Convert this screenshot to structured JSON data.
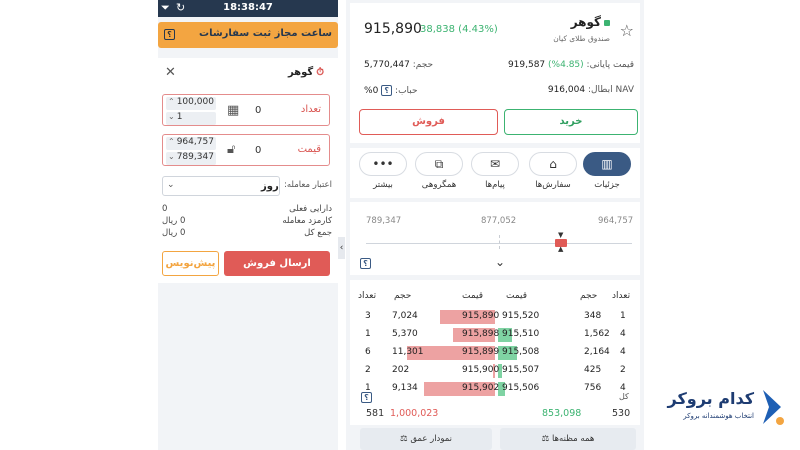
{
  "status_bar": {
    "time": "18:38:47"
  },
  "order_banner": {
    "text": "ساعت مجاز ثبت سفارشات",
    "help_badge": "؟"
  },
  "order_form": {
    "title": "گوهر",
    "close_glyph": "✕",
    "quantity": {
      "label": "تعداد",
      "value": "0",
      "step_large": "100,000",
      "step_small": "1"
    },
    "price": {
      "label": "قیمت",
      "value": "0",
      "upper": "964,757",
      "lower": "789,347"
    },
    "validity": {
      "label": "اعتبار معامله:",
      "value": "روز"
    },
    "info": [
      {
        "label": "دارایی فعلی",
        "value": "0"
      },
      {
        "label": "کارمزد معامله",
        "value": "0 ریال"
      },
      {
        "label": "جمع کل",
        "value": "0 ریال"
      }
    ],
    "send_sell_label": "ارسال فروش",
    "draft_label": "پیش‌نویس"
  },
  "collapse_glyph": "‹",
  "symbol": {
    "name": "گوهر",
    "subtitle": "صندوق طلای کیان",
    "last_price": "915,890",
    "change": "38,838 (4.43%)",
    "final_price_label": "قیمت پایانی:",
    "final_price": "919,587",
    "final_change": "(4.85%)",
    "volume_label": "حجم:",
    "volume": "5,770,447",
    "nav_label": "NAV ابطال:",
    "nav": "916,004",
    "bubble_label": "حباب:",
    "bubble": "0%",
    "buy_label": "خرید",
    "sell_label": "فروش"
  },
  "tabs": [
    {
      "label": "جزئیات",
      "icon": "chart-bars-icon",
      "glyph": "▥",
      "active": true
    },
    {
      "label": "سفارش‌ها",
      "icon": "basket-icon",
      "glyph": "⌂",
      "active": false
    },
    {
      "label": "پیام‌ها",
      "icon": "message-icon",
      "glyph": "✉",
      "active": false
    },
    {
      "label": "همگروهی",
      "icon": "compare-icon",
      "glyph": "⧉",
      "active": false
    },
    {
      "label": "بیشتر",
      "icon": "more-icon",
      "glyph": "•••",
      "active": false
    }
  ],
  "price_range": {
    "low": "789,347",
    "mid": "877,052",
    "high": "964,757",
    "expand_glyph": "⌄",
    "help_badge": "؟"
  },
  "orderbook": {
    "headers": {
      "count": "تعداد",
      "volume": "حجم",
      "price": "قیمت"
    },
    "rows": [
      {
        "buy_count": "1",
        "buy_volume": "348",
        "buy_price": "915,520",
        "sell_price": "915,890",
        "sell_volume": "7,024",
        "sell_count": "3",
        "buy_bar": 0.0,
        "sell_bar": 0.62
      },
      {
        "buy_count": "4",
        "buy_volume": "1,562",
        "buy_price": "915,510",
        "sell_price": "915,898",
        "sell_volume": "5,370",
        "sell_count": "1",
        "buy_bar": 0.14,
        "sell_bar": 0.48
      },
      {
        "buy_count": "4",
        "buy_volume": "2,164",
        "buy_price": "915,508",
        "sell_price": "915,899",
        "sell_volume": "11,301",
        "sell_count": "6",
        "buy_bar": 0.19,
        "sell_bar": 1.0
      },
      {
        "buy_count": "2",
        "buy_volume": "425",
        "buy_price": "915,507",
        "sell_price": "915,900",
        "sell_volume": "202",
        "sell_count": "2",
        "buy_bar": 0.04,
        "sell_bar": 0.02
      },
      {
        "buy_count": "4",
        "buy_volume": "756",
        "buy_price": "915,506",
        "sell_price": "915,902",
        "sell_volume": "9,134",
        "sell_count": "1",
        "buy_bar": 0.07,
        "sell_bar": 0.81
      }
    ],
    "total_label": "کل",
    "help_badge": "؟",
    "totals": {
      "buy_count": "530",
      "buy_volume": "853,098",
      "sell_volume": "1,000,023",
      "sell_count": "581"
    }
  },
  "bottom_buttons": {
    "all_orders": "همه مظنه‌ها",
    "depth_chart": "نمودار عمق"
  },
  "brand": {
    "title": "کدام بروکر",
    "subtitle": "انتخاب هوشمندانه بروکر"
  },
  "colors": {
    "navy": "#26384f",
    "orange": "#f3a541",
    "green": "#3cb371",
    "red": "#e05b57",
    "tab_active": "#3a5a84"
  }
}
